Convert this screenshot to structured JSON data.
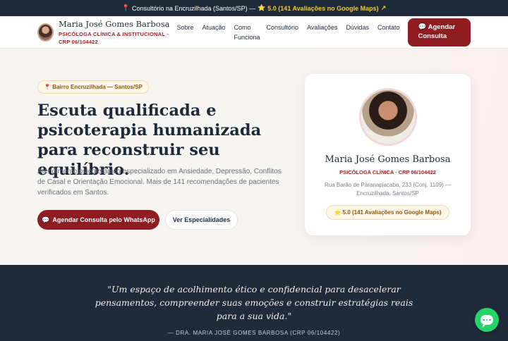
{
  "topbar": {
    "pin_icon": "📍",
    "location_text": "Consultório na Encruzilhada (Santos/SP) —",
    "star_icon": "⭐",
    "rating_text": "5.0 (141 Avaliações no Google Maps)",
    "arrow": "↗"
  },
  "nav": {
    "name": "Maria José Gomes Barbosa",
    "subtitle": "PSICÓLOGA CLÍNICA & INSTITUCIONAL · CRP 06/104422",
    "items": [
      "Sobre",
      "Atuação",
      "Como Funciona",
      "Consultório",
      "Avaliações",
      "Dúvidas",
      "Contato"
    ],
    "cta_icon": "💬",
    "cta_label": "Agendar Consulta"
  },
  "hero": {
    "chip_icon": "📍",
    "chip_text": "Bairro Encruzilhada — Santos/SP",
    "headline": "Escuta qualificada e psicoterapia humanizada para reconstruir seu equilíbrio.",
    "lead": "Atendimento psicoterápico especializado em Ansiedade, Depressão, Conflitos de Casal e Orientação Emocional. Mais de 141 recomendações de pacientes verificados em Santos.",
    "primary_icon": "💬",
    "primary_label": "Agendar Consulta pelo WhatsApp",
    "secondary_label": "Ver Especialidades"
  },
  "card": {
    "name": "Maria José Gomes Barbosa",
    "role": "PSICÓLOGA CLÍNICA · CRP 06/104422",
    "address": "Rua Barão de Paranapiacaba, 233 (Conj. 1109) — Encruzilhada, Santos/SP",
    "badge_icon": "⭐",
    "badge_text": "5.0 (141 Avaliações no Google Maps)"
  },
  "quote": {
    "text": "\"Um espaço de acolhimento ético e confidencial para desacelerar pensamentos, compreender suas emoções e construir estratégias reais para a sua vida.\"",
    "author": "— DRA. MARIA JOSÉ GOMES BARBOSA (CRP 06/104422)"
  },
  "colors": {
    "navy": "#1f2a3b",
    "accent": "#8e1c20",
    "gold": "#f4c430",
    "whatsapp": "#25d366"
  }
}
